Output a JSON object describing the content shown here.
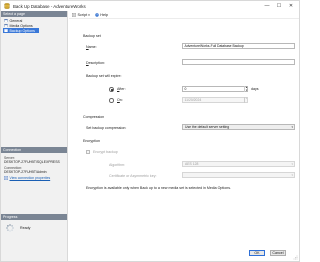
{
  "window": {
    "title": "Back Up Database - AdventureWorks",
    "minimize": "—",
    "maximize": "☐",
    "close": "✕"
  },
  "left": {
    "select_page_header": "Select a page",
    "pages": [
      {
        "label": "General"
      },
      {
        "label": "Media Options"
      },
      {
        "label": "Backup Options"
      }
    ],
    "connection_header": "Connection",
    "server_label": "Server:",
    "server_value": "DESKTOP-27FUH5T\\SQLEXPRESS",
    "connection_label": "Connection:",
    "connection_value": "DESKTOP-27FUH5T\\Admin",
    "view_connection_link": "View connection properties",
    "progress_header": "Progress",
    "progress_status": "Ready"
  },
  "toolbar": {
    "script_label": "Script",
    "help_label": "Help"
  },
  "backup_set": {
    "group_label": "Backup set",
    "name_label": "Name:",
    "name_value": "AdventureWorks-Full Database Backup",
    "description_label": "Description:",
    "description_value": "",
    "expire_label": "Backup set will expire:",
    "after_label": "After:",
    "after_value": "0",
    "days_label": "days",
    "on_label": "On:",
    "on_value": "11/20/2024"
  },
  "compression": {
    "group_label": "Compression",
    "set_label": "Set backup compression:",
    "set_value": "Use the default server setting"
  },
  "encryption": {
    "group_label": "Encryption",
    "encrypt_label": "Encrypt backup",
    "algorithm_label": "Algorithm:",
    "algorithm_value": "AES 128",
    "cert_label": "Certificate or Asymmetric key:",
    "cert_value": "",
    "note": "Encryption is available only when Back up to a new media set is selected in Media Options."
  },
  "footer": {
    "ok_label": "OK",
    "cancel_label": "Cancel"
  },
  "colors": {
    "selected_page": "#3a78d8",
    "section_header": "#7a8594",
    "link": "#1a5fb4"
  }
}
